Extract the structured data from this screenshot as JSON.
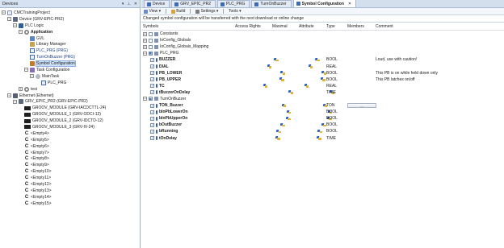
{
  "devices_panel": {
    "title": "Devices",
    "controls": [
      "▾",
      "⊥",
      "✕"
    ],
    "tree": [
      {
        "label": "CMCTrainingProject",
        "indent": 0,
        "exp": "−",
        "icon": "proj",
        "style": ""
      },
      {
        "label": "Device (GRV-EPIC-PR2)",
        "indent": 1,
        "exp": "−",
        "icon": "device",
        "style": ""
      },
      {
        "label": "PLC Logic",
        "indent": 2,
        "exp": "−",
        "icon": "plc",
        "style": ""
      },
      {
        "label": "Application",
        "indent": 3,
        "exp": "−",
        "icon": "gear",
        "style": "bold"
      },
      {
        "label": "GVL",
        "indent": 4,
        "exp": "",
        "icon": "gvl",
        "style": ""
      },
      {
        "label": "Library Manager",
        "indent": 4,
        "exp": "",
        "icon": "lib",
        "style": ""
      },
      {
        "label": "PLC_PRG (PRG)",
        "indent": 4,
        "exp": "",
        "icon": "pou",
        "style": "blue"
      },
      {
        "label": "TurnOnBuzzer (PRG)",
        "indent": 4,
        "exp": "",
        "icon": "pou",
        "style": "blue"
      },
      {
        "label": "Symbol Configuration",
        "indent": 4,
        "exp": "",
        "icon": "sym",
        "style": "selected"
      },
      {
        "label": "Task Configuration",
        "indent": 4,
        "exp": "−",
        "icon": "task",
        "style": ""
      },
      {
        "label": "MainTask",
        "indent": 5,
        "exp": "−",
        "icon": "taskx",
        "style": ""
      },
      {
        "label": "PLC_PRG",
        "indent": 6,
        "exp": "",
        "icon": "pou",
        "style": ""
      },
      {
        "label": "test",
        "indent": 3,
        "exp": "+",
        "icon": "gear",
        "style": ""
      },
      {
        "label": "Ethernet (Ethernet)",
        "indent": 1,
        "exp": "−",
        "icon": "eth",
        "style": ""
      },
      {
        "label": "GRV_EPIC_PR2 (GRV-EPIC-PR2)",
        "indent": 2,
        "exp": "−",
        "icon": "device",
        "style": ""
      },
      {
        "label": "GROOV_MODULE (GRV-IACDCTTL-24)",
        "indent": 3,
        "exp": "",
        "icon": "mod",
        "style": ""
      },
      {
        "label": "GROOV_MODULE_1 (GRV-ODCI-12)",
        "indent": 3,
        "exp": "",
        "icon": "mod",
        "style": ""
      },
      {
        "label": "GROOV_MODULE_2 (GRV-IDCTD-12)",
        "indent": 3,
        "exp": "",
        "icon": "mod",
        "style": ""
      },
      {
        "label": "GROOV_MODULE_3 (GRV-IV-24)",
        "indent": 3,
        "exp": "",
        "icon": "mod",
        "style": ""
      },
      {
        "label": "<Empty4>",
        "indent": 3,
        "exp": "",
        "icon": "empty",
        "style": ""
      },
      {
        "label": "<Empty5>",
        "indent": 3,
        "exp": "",
        "icon": "empty",
        "style": ""
      },
      {
        "label": "<Empty6>",
        "indent": 3,
        "exp": "",
        "icon": "empty",
        "style": ""
      },
      {
        "label": "<Empty7>",
        "indent": 3,
        "exp": "",
        "icon": "empty",
        "style": ""
      },
      {
        "label": "<Empty8>",
        "indent": 3,
        "exp": "",
        "icon": "empty",
        "style": ""
      },
      {
        "label": "<Empty9>",
        "indent": 3,
        "exp": "",
        "icon": "empty",
        "style": ""
      },
      {
        "label": "<Empty10>",
        "indent": 3,
        "exp": "",
        "icon": "empty",
        "style": ""
      },
      {
        "label": "<Empty11>",
        "indent": 3,
        "exp": "",
        "icon": "empty",
        "style": ""
      },
      {
        "label": "<Empty12>",
        "indent": 3,
        "exp": "",
        "icon": "empty",
        "style": ""
      },
      {
        "label": "<Empty13>",
        "indent": 3,
        "exp": "",
        "icon": "empty",
        "style": ""
      },
      {
        "label": "<Empty14>",
        "indent": 3,
        "exp": "",
        "icon": "empty",
        "style": ""
      },
      {
        "label": "<Empty15>",
        "indent": 3,
        "exp": "",
        "icon": "empty",
        "style": ""
      }
    ]
  },
  "tabs": [
    {
      "label": "Device",
      "active": false
    },
    {
      "label": "GRV_EPIC_PR2",
      "active": false
    },
    {
      "label": "PLC_PRG",
      "active": false
    },
    {
      "label": "TurnOnBuzzer",
      "active": false
    },
    {
      "label": "Symbol Configuration",
      "active": true
    }
  ],
  "tab_close": "✕",
  "toolbar": {
    "view_label": "View ▾",
    "build_label": "Build",
    "settings_label": "Settings ▾",
    "tools_label": "Tools ▾"
  },
  "info_text": "Changed symbol configuration will be transferred with the next download or online change",
  "grid": {
    "headers": {
      "symbols": "Symbols",
      "access": "Access Rights",
      "maximal": "Maximal",
      "attribute": "Attribute",
      "type": "Type",
      "members": "Members",
      "comment": "Comment"
    },
    "rows": [
      {
        "level": 0,
        "exp": "+",
        "check": "empty",
        "icon": "folder",
        "name": "Constants",
        "bold": false,
        "access": false,
        "maximal": false,
        "type": "",
        "members": "",
        "comment": ""
      },
      {
        "level": 0,
        "exp": "+",
        "check": "empty",
        "icon": "folder",
        "name": "IoConfig_Globals",
        "bold": false,
        "access": false,
        "maximal": false,
        "type": "",
        "members": "",
        "comment": ""
      },
      {
        "level": 0,
        "exp": "+",
        "check": "empty",
        "icon": "folder",
        "name": "IoConfig_Globals_Mapping",
        "bold": false,
        "access": false,
        "maximal": false,
        "type": "",
        "members": "",
        "comment": ""
      },
      {
        "level": 0,
        "exp": "−",
        "check": "half",
        "icon": "folder",
        "name": "PLC_PRG",
        "bold": false,
        "access": false,
        "maximal": false,
        "type": "",
        "members": "",
        "comment": ""
      },
      {
        "level": 1,
        "exp": "",
        "check": "checked",
        "icon": "var",
        "name": "BUZZER",
        "bold": true,
        "access": true,
        "maximal": true,
        "type": "BOOL",
        "members": "",
        "comment": "Loud, use with caution!"
      },
      {
        "level": 1,
        "exp": "",
        "check": "checked",
        "icon": "var",
        "name": "DIAL",
        "bold": true,
        "access": true,
        "maximal": true,
        "type": "REAL",
        "members": "",
        "comment": ""
      },
      {
        "level": 1,
        "exp": "",
        "check": "checked",
        "icon": "var",
        "name": "PB_LOWER",
        "bold": true,
        "access": true,
        "maximal": true,
        "type": "BOOL",
        "members": "",
        "comment": "This PB is on while held down only"
      },
      {
        "level": 1,
        "exp": "",
        "check": "checked",
        "icon": "var",
        "name": "PB_UPPER",
        "bold": true,
        "access": true,
        "maximal": true,
        "type": "BOOL",
        "members": "",
        "comment": "This PB latches on/off"
      },
      {
        "level": 1,
        "exp": "",
        "check": "checked",
        "icon": "var",
        "name": "TC",
        "bold": true,
        "access": true,
        "maximal": true,
        "type": "REAL",
        "members": "",
        "comment": ""
      },
      {
        "level": 1,
        "exp": "",
        "check": "checked",
        "icon": "var",
        "name": "tBuzzerOnDelay",
        "bold": true,
        "access": true,
        "maximal": true,
        "type": "TIME",
        "members": "",
        "comment": ""
      },
      {
        "level": 0,
        "exp": "−",
        "check": "half",
        "icon": "folder",
        "name": "TurnOnBuzzer",
        "bold": false,
        "access": false,
        "maximal": false,
        "type": "",
        "members": "",
        "comment": ""
      },
      {
        "level": 1,
        "exp": "",
        "check": "checked",
        "icon": "var",
        "name": "TON_Buzzer",
        "bold": true,
        "access": true,
        "maximal": true,
        "type": "TON",
        "members": "...",
        "comment": ""
      },
      {
        "level": 1,
        "exp": "",
        "check": "checked",
        "icon": "var",
        "name": "bInPbLowerOn",
        "bold": true,
        "access": true,
        "maximal": true,
        "type": "BOOL",
        "members": "",
        "comment": ""
      },
      {
        "level": 1,
        "exp": "",
        "check": "checked",
        "icon": "var",
        "name": "bInPbUpperOn",
        "bold": true,
        "access": true,
        "maximal": true,
        "type": "BOOL",
        "members": "",
        "comment": ""
      },
      {
        "level": 1,
        "exp": "",
        "check": "checked",
        "icon": "var",
        "name": "bOutBuzzer",
        "bold": true,
        "access": true,
        "maximal": true,
        "type": "BOOL",
        "members": "",
        "comment": ""
      },
      {
        "level": 1,
        "exp": "",
        "check": "checked",
        "icon": "var",
        "name": "bRunning",
        "bold": true,
        "access": true,
        "maximal": true,
        "type": "BOOL",
        "members": "",
        "comment": ""
      },
      {
        "level": 1,
        "exp": "",
        "check": "checked",
        "icon": "var",
        "name": "tOnDelay",
        "bold": true,
        "access": true,
        "maximal": true,
        "type": "TIME",
        "members": "",
        "comment": ""
      }
    ]
  }
}
